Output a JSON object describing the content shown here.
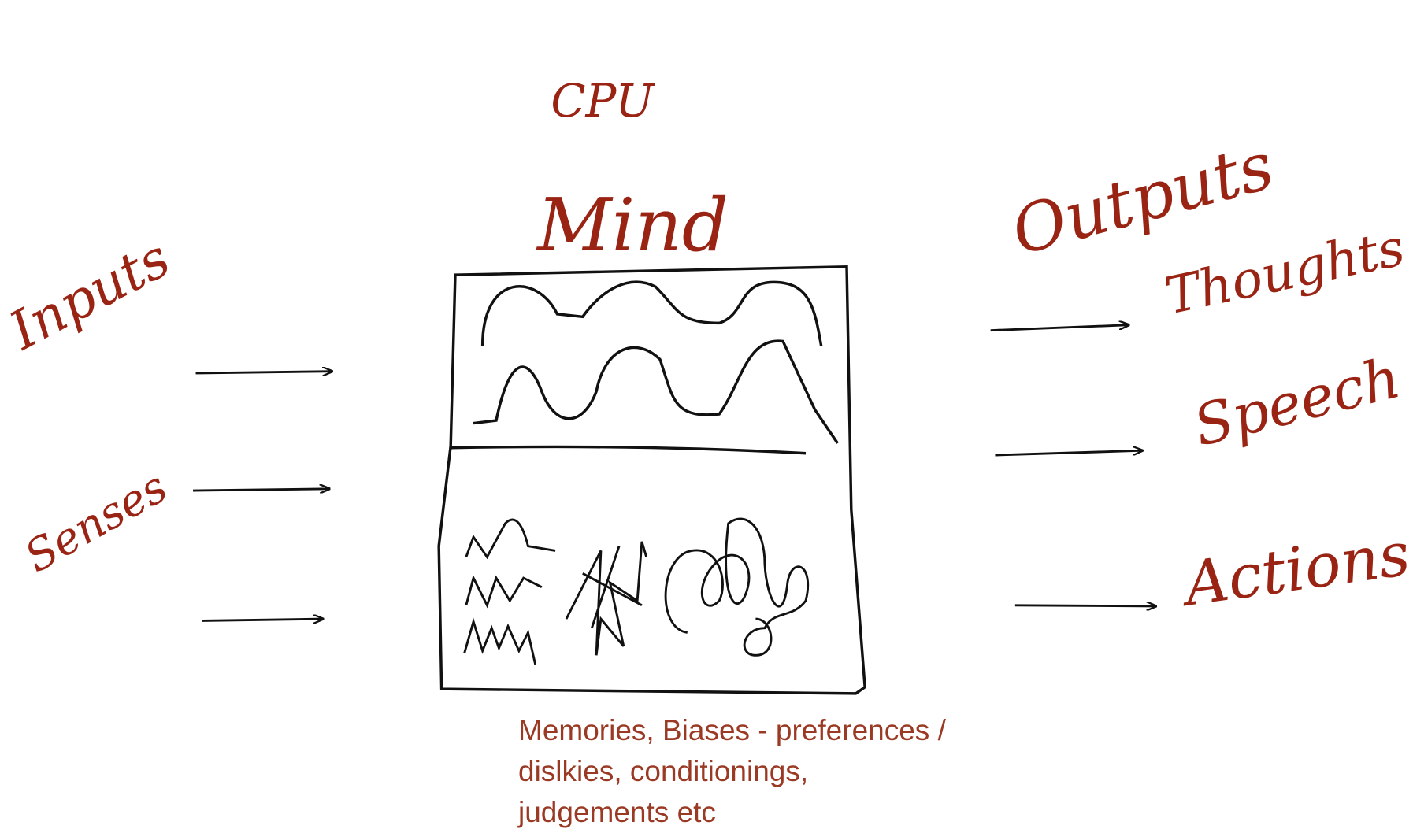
{
  "labels": {
    "inputs": "Inputs",
    "senses": "Senses",
    "cpu": "CPU",
    "mind": "Mind",
    "outputs": "Outputs",
    "thoughts": "Thoughts",
    "speech": "Speech",
    "actions": "Actions"
  },
  "caption": {
    "lines": [
      "Memories, Biases - preferences /",
      "dislkies, conditionings,",
      "judgements etc"
    ]
  },
  "colors": {
    "ink": "#111111",
    "handwriting": "#9a2414",
    "caption": "#9b3a24"
  }
}
